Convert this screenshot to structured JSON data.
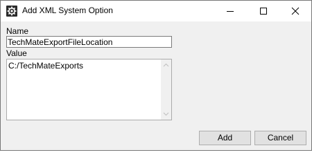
{
  "window": {
    "title": "Add XML System Option",
    "icon": "gear-icon",
    "controls": [
      "minimize-icon",
      "maximize-icon",
      "close-icon"
    ]
  },
  "form": {
    "name_label": "Name",
    "name_value": "TechMateExportFileLocation",
    "value_label": "Value",
    "value_text": "C:/TechMateExports"
  },
  "buttons": {
    "add_label": "Add",
    "cancel_label": "Cancel"
  },
  "colors": {
    "titlebar_bg": "#ffffff",
    "client_bg": "#f0f0f0",
    "button_bg": "#e1e1e1",
    "button_border": "#adadad"
  }
}
